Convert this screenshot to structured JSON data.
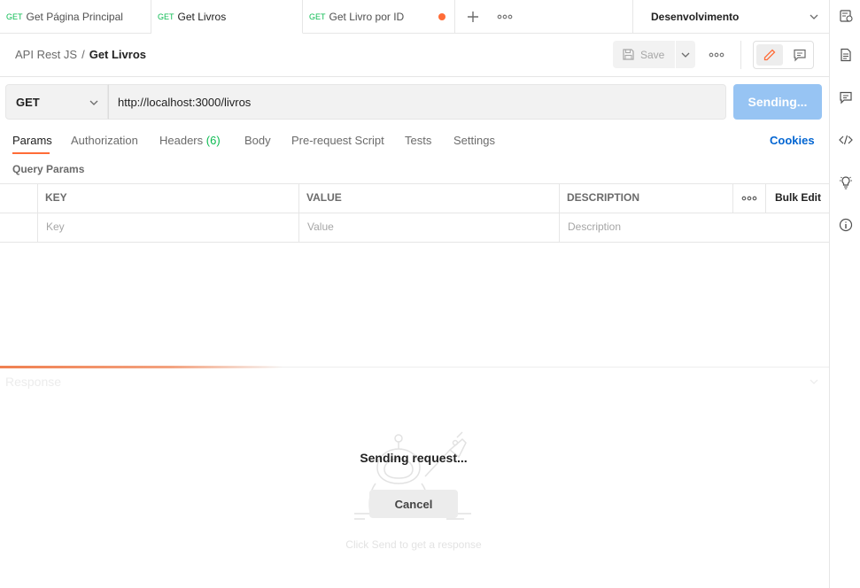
{
  "tabs": [
    {
      "method": "GET",
      "label": "Get Página Principal"
    },
    {
      "method": "GET",
      "label": "Get Livros"
    },
    {
      "method": "GET",
      "label": "Get Livro por ID"
    }
  ],
  "environment": "Desenvolvimento",
  "breadcrumb": {
    "collection": "API Rest JS",
    "separator": "/",
    "request": "Get Livros"
  },
  "toolbar": {
    "save_label": "Save"
  },
  "request": {
    "method": "GET",
    "url": "http://localhost:3000/livros",
    "send_label": "Sending..."
  },
  "request_tabs": {
    "params": "Params",
    "authorization": "Authorization",
    "headers": "Headers",
    "headers_count": "(6)",
    "body": "Body",
    "pre_request": "Pre-request Script",
    "tests": "Tests",
    "settings": "Settings",
    "cookies": "Cookies"
  },
  "params": {
    "section_title": "Query Params",
    "columns": {
      "key": "KEY",
      "value": "VALUE",
      "description": "DESCRIPTION"
    },
    "bulk_edit": "Bulk Edit",
    "placeholders": {
      "key": "Key",
      "value": "Value",
      "description": "Description"
    }
  },
  "response": {
    "title": "Response",
    "sending_text": "Sending request...",
    "cancel_label": "Cancel",
    "hint": "Click Send to get a response"
  },
  "colors": {
    "accent": "#ff6c37",
    "send_disabled": "#97c4f3",
    "method_get": "#0cbb52",
    "link": "#0265d2"
  }
}
